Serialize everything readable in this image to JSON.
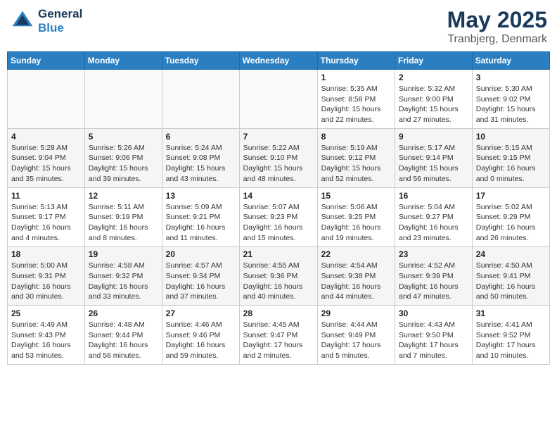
{
  "header": {
    "logo_line1": "General",
    "logo_line2": "Blue",
    "title": "May 2025",
    "subtitle": "Tranbjerg, Denmark"
  },
  "days_of_week": [
    "Sunday",
    "Monday",
    "Tuesday",
    "Wednesday",
    "Thursday",
    "Friday",
    "Saturday"
  ],
  "weeks": [
    [
      {
        "day": "",
        "info": ""
      },
      {
        "day": "",
        "info": ""
      },
      {
        "day": "",
        "info": ""
      },
      {
        "day": "",
        "info": ""
      },
      {
        "day": "1",
        "info": "Sunrise: 5:35 AM\nSunset: 8:58 PM\nDaylight: 15 hours\nand 22 minutes."
      },
      {
        "day": "2",
        "info": "Sunrise: 5:32 AM\nSunset: 9:00 PM\nDaylight: 15 hours\nand 27 minutes."
      },
      {
        "day": "3",
        "info": "Sunrise: 5:30 AM\nSunset: 9:02 PM\nDaylight: 15 hours\nand 31 minutes."
      }
    ],
    [
      {
        "day": "4",
        "info": "Sunrise: 5:28 AM\nSunset: 9:04 PM\nDaylight: 15 hours\nand 35 minutes."
      },
      {
        "day": "5",
        "info": "Sunrise: 5:26 AM\nSunset: 9:06 PM\nDaylight: 15 hours\nand 39 minutes."
      },
      {
        "day": "6",
        "info": "Sunrise: 5:24 AM\nSunset: 9:08 PM\nDaylight: 15 hours\nand 43 minutes."
      },
      {
        "day": "7",
        "info": "Sunrise: 5:22 AM\nSunset: 9:10 PM\nDaylight: 15 hours\nand 48 minutes."
      },
      {
        "day": "8",
        "info": "Sunrise: 5:19 AM\nSunset: 9:12 PM\nDaylight: 15 hours\nand 52 minutes."
      },
      {
        "day": "9",
        "info": "Sunrise: 5:17 AM\nSunset: 9:14 PM\nDaylight: 15 hours\nand 56 minutes."
      },
      {
        "day": "10",
        "info": "Sunrise: 5:15 AM\nSunset: 9:15 PM\nDaylight: 16 hours\nand 0 minutes."
      }
    ],
    [
      {
        "day": "11",
        "info": "Sunrise: 5:13 AM\nSunset: 9:17 PM\nDaylight: 16 hours\nand 4 minutes."
      },
      {
        "day": "12",
        "info": "Sunrise: 5:11 AM\nSunset: 9:19 PM\nDaylight: 16 hours\nand 8 minutes."
      },
      {
        "day": "13",
        "info": "Sunrise: 5:09 AM\nSunset: 9:21 PM\nDaylight: 16 hours\nand 11 minutes."
      },
      {
        "day": "14",
        "info": "Sunrise: 5:07 AM\nSunset: 9:23 PM\nDaylight: 16 hours\nand 15 minutes."
      },
      {
        "day": "15",
        "info": "Sunrise: 5:06 AM\nSunset: 9:25 PM\nDaylight: 16 hours\nand 19 minutes."
      },
      {
        "day": "16",
        "info": "Sunrise: 5:04 AM\nSunset: 9:27 PM\nDaylight: 16 hours\nand 23 minutes."
      },
      {
        "day": "17",
        "info": "Sunrise: 5:02 AM\nSunset: 9:29 PM\nDaylight: 16 hours\nand 26 minutes."
      }
    ],
    [
      {
        "day": "18",
        "info": "Sunrise: 5:00 AM\nSunset: 9:31 PM\nDaylight: 16 hours\nand 30 minutes."
      },
      {
        "day": "19",
        "info": "Sunrise: 4:58 AM\nSunset: 9:32 PM\nDaylight: 16 hours\nand 33 minutes."
      },
      {
        "day": "20",
        "info": "Sunrise: 4:57 AM\nSunset: 9:34 PM\nDaylight: 16 hours\nand 37 minutes."
      },
      {
        "day": "21",
        "info": "Sunrise: 4:55 AM\nSunset: 9:36 PM\nDaylight: 16 hours\nand 40 minutes."
      },
      {
        "day": "22",
        "info": "Sunrise: 4:54 AM\nSunset: 9:38 PM\nDaylight: 16 hours\nand 44 minutes."
      },
      {
        "day": "23",
        "info": "Sunrise: 4:52 AM\nSunset: 9:39 PM\nDaylight: 16 hours\nand 47 minutes."
      },
      {
        "day": "24",
        "info": "Sunrise: 4:50 AM\nSunset: 9:41 PM\nDaylight: 16 hours\nand 50 minutes."
      }
    ],
    [
      {
        "day": "25",
        "info": "Sunrise: 4:49 AM\nSunset: 9:43 PM\nDaylight: 16 hours\nand 53 minutes."
      },
      {
        "day": "26",
        "info": "Sunrise: 4:48 AM\nSunset: 9:44 PM\nDaylight: 16 hours\nand 56 minutes."
      },
      {
        "day": "27",
        "info": "Sunrise: 4:46 AM\nSunset: 9:46 PM\nDaylight: 16 hours\nand 59 minutes."
      },
      {
        "day": "28",
        "info": "Sunrise: 4:45 AM\nSunset: 9:47 PM\nDaylight: 17 hours\nand 2 minutes."
      },
      {
        "day": "29",
        "info": "Sunrise: 4:44 AM\nSunset: 9:49 PM\nDaylight: 17 hours\nand 5 minutes."
      },
      {
        "day": "30",
        "info": "Sunrise: 4:43 AM\nSunset: 9:50 PM\nDaylight: 17 hours\nand 7 minutes."
      },
      {
        "day": "31",
        "info": "Sunrise: 4:41 AM\nSunset: 9:52 PM\nDaylight: 17 hours\nand 10 minutes."
      }
    ]
  ]
}
